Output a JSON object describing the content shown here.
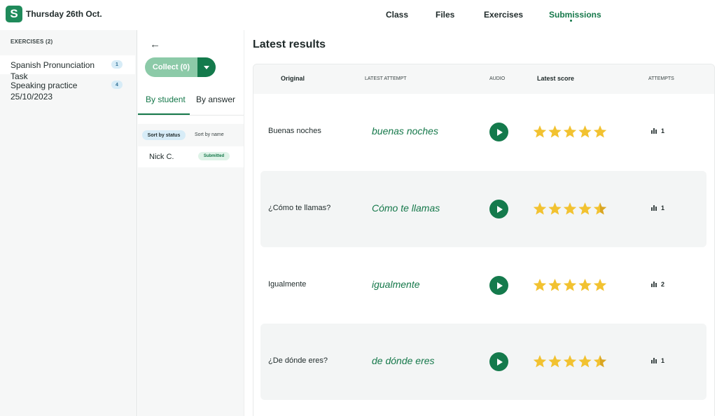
{
  "topbar": {
    "logo_letter": "S",
    "date": "Thursday 26th Oct.",
    "nav": [
      "Class",
      "Files",
      "Exercises",
      "Submissions"
    ],
    "active_nav": "Submissions"
  },
  "exercises": {
    "header": "EXERCISES (2)",
    "items": [
      {
        "label": "Spanish Pronunciation Task",
        "count": "1"
      },
      {
        "label": "Speaking practice 25/10/2023",
        "count": "4"
      }
    ]
  },
  "middle": {
    "collect_label": "Collect (0)",
    "tabs": [
      "By student",
      "By answer"
    ],
    "sort_status": "Sort by status",
    "sort_name": "Sort by name",
    "student": {
      "name": "Nick C.",
      "status": "Submitted"
    }
  },
  "results": {
    "title": "Latest results",
    "columns": [
      "Original",
      "LATEST ATTEMPT",
      "AUDIO",
      "Latest score",
      "ATTEMPTS"
    ],
    "rows": [
      {
        "original": "Buenas noches",
        "attempt": "buenas noches",
        "score": 5,
        "attempts": "1"
      },
      {
        "original": "¿Cómo te llamas?",
        "attempt": "Cómo te llamas",
        "score": 4.5,
        "attempts": "1"
      },
      {
        "original": "Igualmente",
        "attempt": "igualmente",
        "score": 5,
        "attempts": "2"
      },
      {
        "original": "¿De dónde eres?",
        "attempt": "de dónde eres",
        "score": 4.5,
        "attempts": "1"
      }
    ]
  },
  "colors": {
    "brand": "#1f8a5a",
    "accent_green": "#15784a",
    "star": "#f2c230",
    "star_dark": "#d9a521"
  },
  "icons": {
    "back": "arrow-left-icon",
    "play": "play-icon",
    "attempts": "bar-chart-icon",
    "star": "star-icon"
  }
}
